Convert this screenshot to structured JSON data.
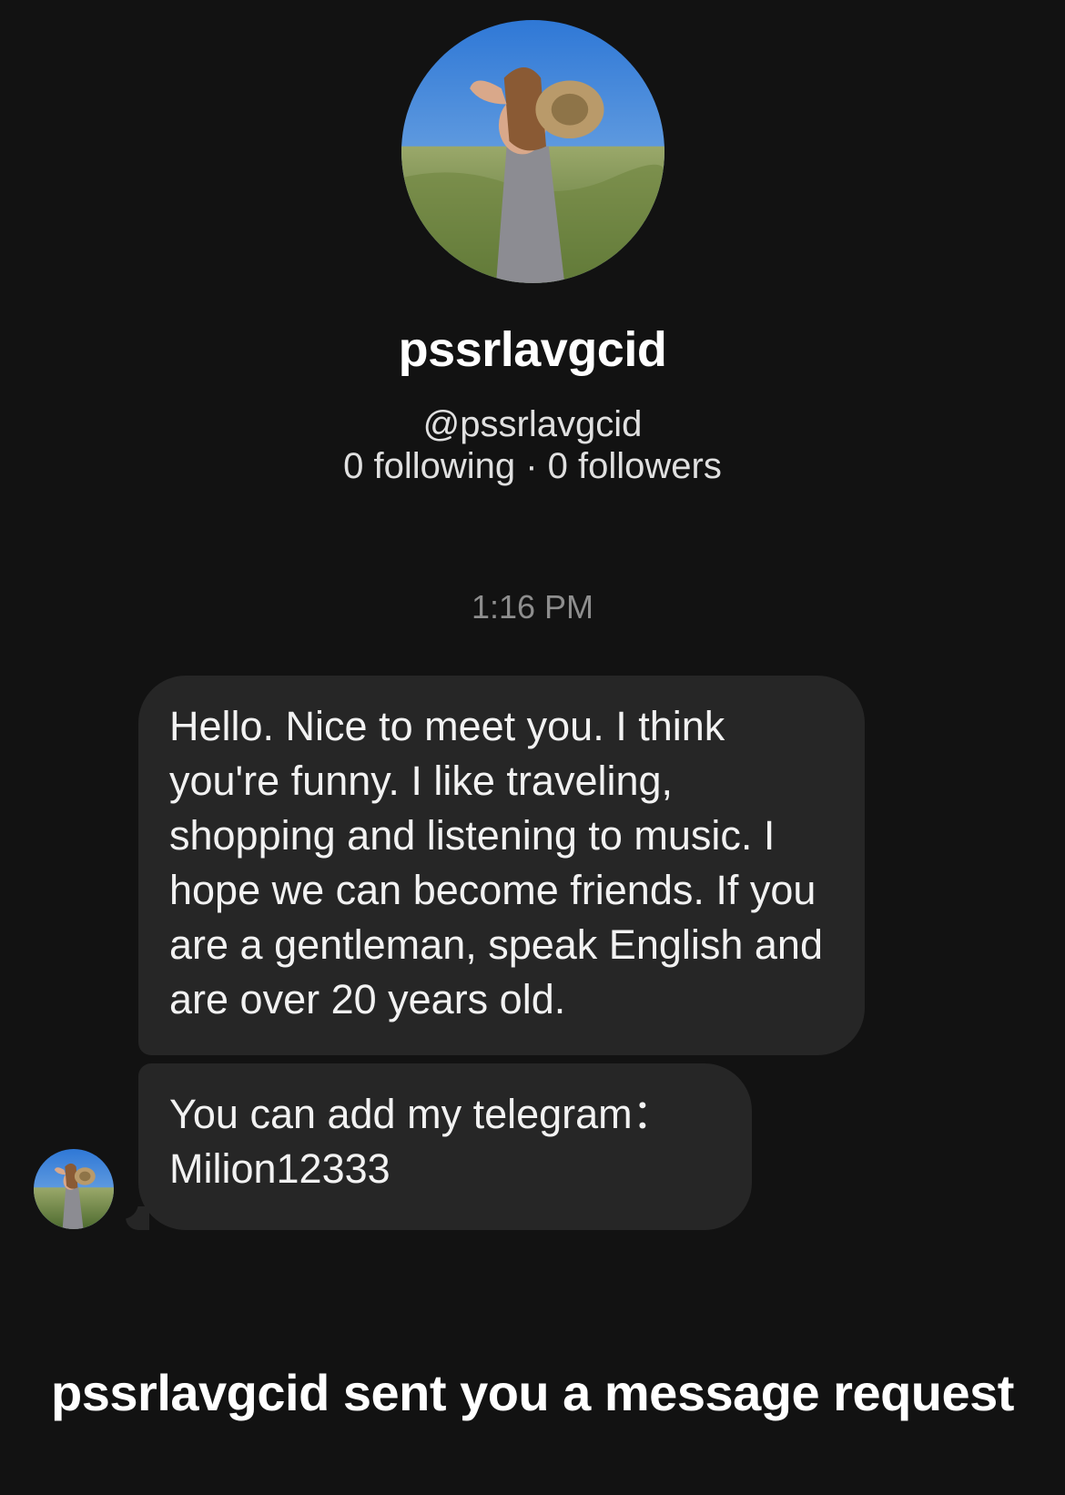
{
  "profile": {
    "display_name": "pssrlavgcid",
    "handle": "@pssrlavgcid",
    "stats": "0 following · 0 followers",
    "avatar_icon": "profile-photo-icon"
  },
  "conversation": {
    "timestamp": "1:16 PM",
    "messages": [
      {
        "text": "Hello. Nice to meet you. I think you're funny. I like traveling, shopping and listening to music. I hope we can become friends. If you are a gentleman, speak English and are over 20 years old."
      },
      {
        "text": "You can add my telegram：Milion12333"
      }
    ]
  },
  "request_notice": {
    "text": "pssrlavgcid sent you a message request"
  },
  "colors": {
    "background": "#121212",
    "bubble": "#262626",
    "timestamp": "#8e8e8e"
  }
}
